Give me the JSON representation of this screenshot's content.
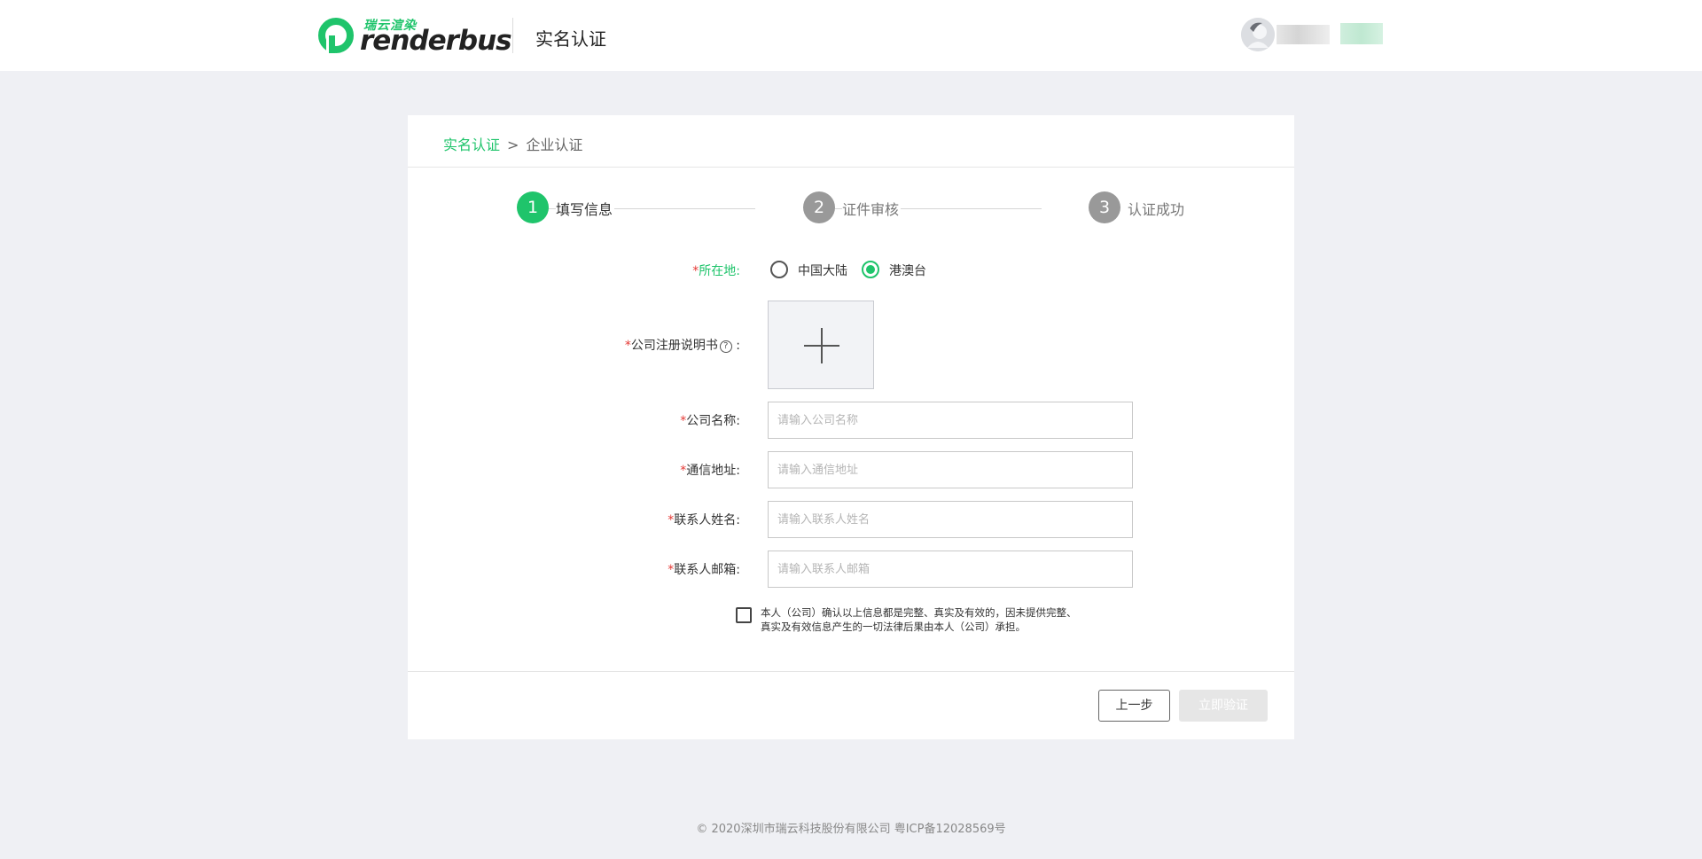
{
  "header": {
    "logo_cn": "瑞云渲染",
    "logo_en": "renderbus",
    "title": "实名认证"
  },
  "breadcrumb": {
    "root": "实名认证",
    "separator": ">",
    "current": "企业认证"
  },
  "steps": [
    {
      "number": "1",
      "label": "填写信息",
      "state": "active"
    },
    {
      "number": "2",
      "label": "证件审核",
      "state": "inactive"
    },
    {
      "number": "3",
      "label": "认证成功",
      "state": "inactive"
    }
  ],
  "form": {
    "location": {
      "label": "所在地:",
      "options": [
        "中国大陆",
        "港澳台"
      ],
      "selected": "港澳台"
    },
    "registration_doc": {
      "label": "公司注册说明书",
      "help": "?",
      "colon": ":"
    },
    "company_name": {
      "label": "公司名称:",
      "placeholder": "请输入公司名称"
    },
    "address": {
      "label": "通信地址:",
      "placeholder": "请输入通信地址"
    },
    "contact_name": {
      "label": "联系人姓名:",
      "placeholder": "请输入联系人姓名"
    },
    "contact_email": {
      "label": "联系人邮箱:",
      "placeholder": "请输入联系人邮箱"
    },
    "required_mark": "*",
    "agreement_line1": "本人（公司）确认以上信息都是完整、真实及有效的，因未提供完整、",
    "agreement_line2": "真实及有效信息产生的一切法律后果由本人（公司）承担。",
    "agreement_checked": false
  },
  "buttons": {
    "prev": "上一步",
    "submit": "立即验证"
  },
  "footer": {
    "text": "© 2020深圳市瑞云科技股份有限公司 粤ICP备12028569号"
  },
  "colors": {
    "accent": "#1fc46b",
    "required": "#e53935",
    "step_inactive": "#999999",
    "page_bg": "#eff0f4"
  }
}
